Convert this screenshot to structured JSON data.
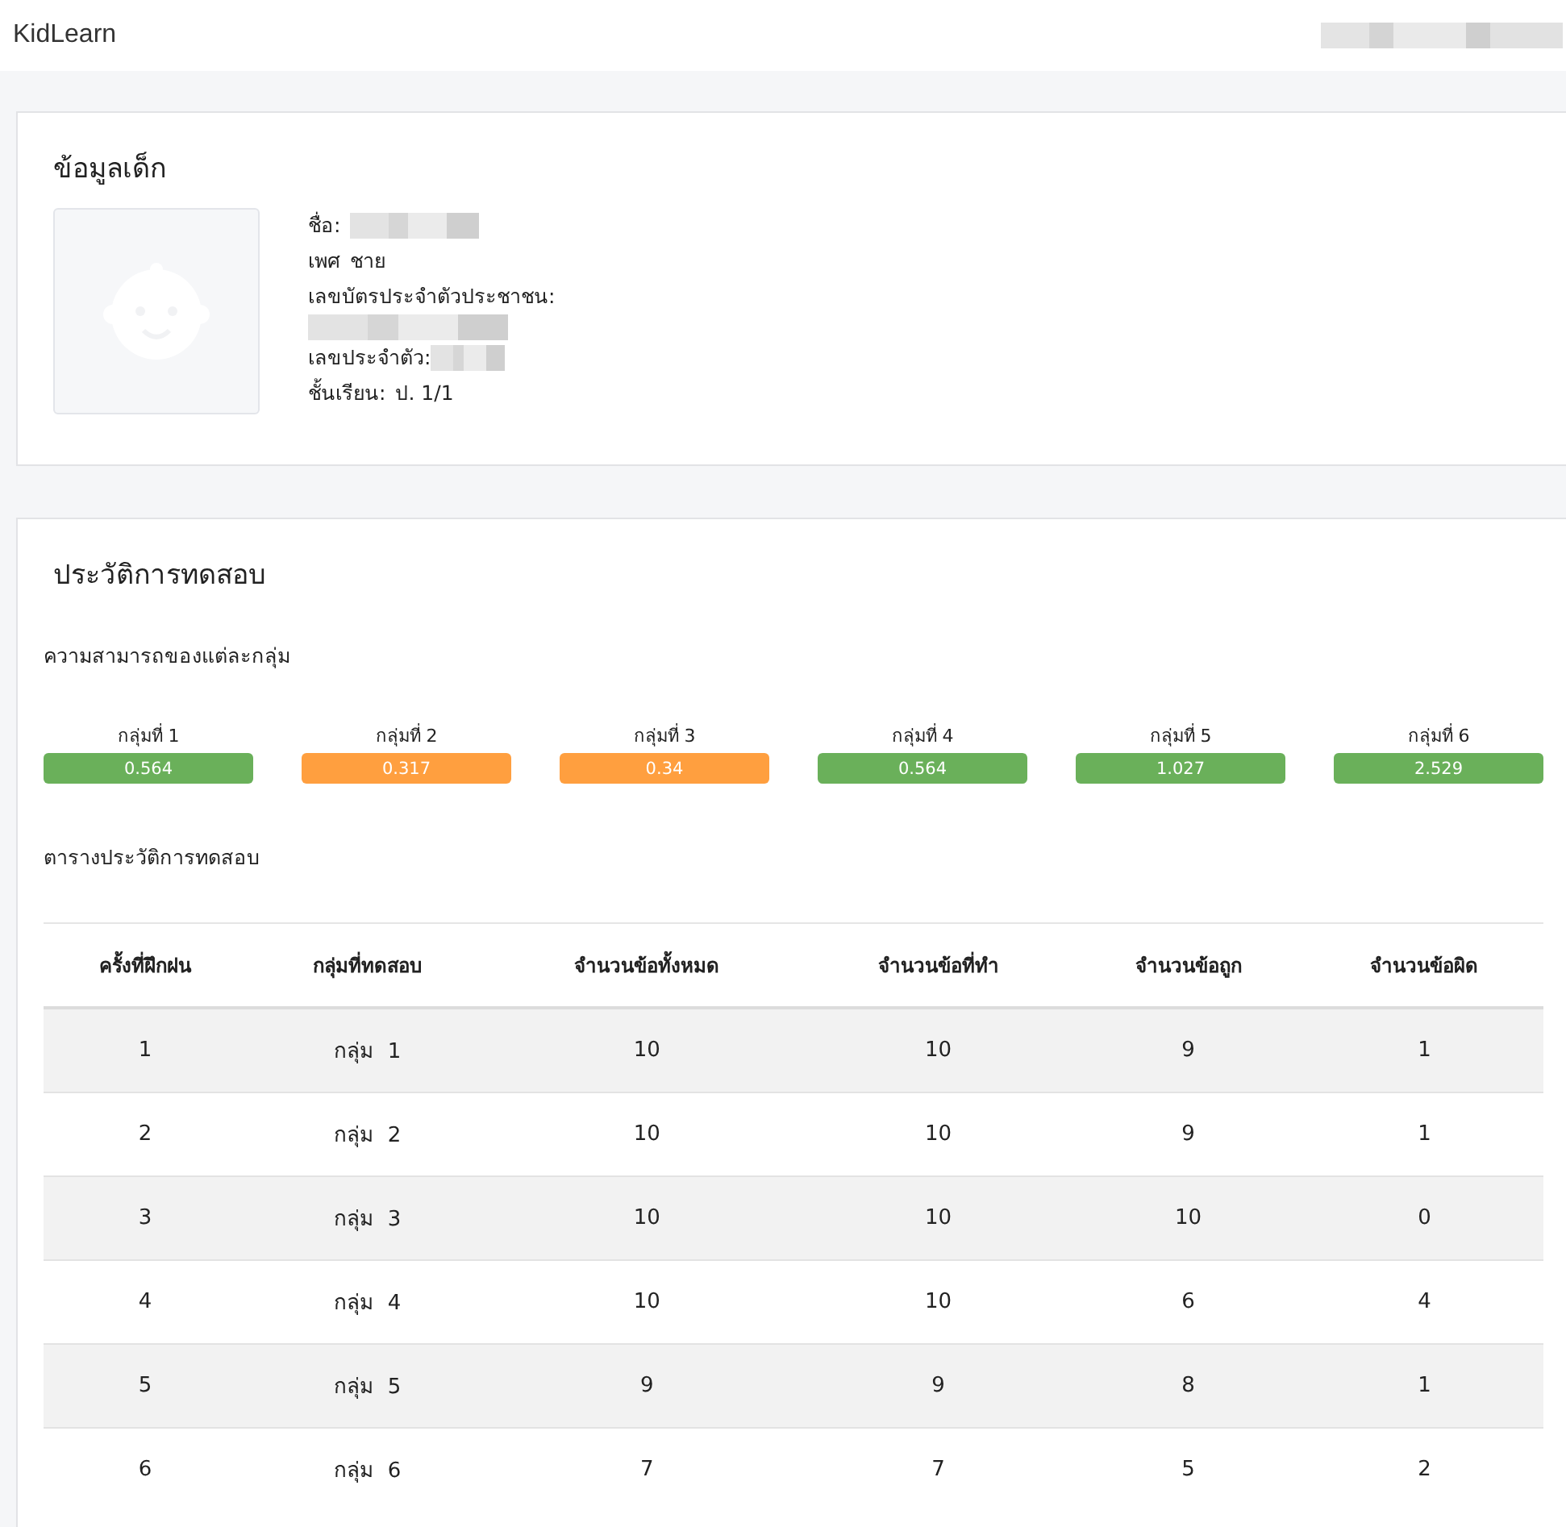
{
  "app_name": "KidLearn",
  "child_info": {
    "title": "ข้อมูลเด็ก",
    "name_label": "ชื่อ:",
    "gender_label": "เพศ",
    "gender": "ชาย",
    "id_card_label": "เลขบัตรประจำตัวประชาชน:",
    "student_id_label": "เลขประจำตัว:",
    "grade_label": "ชั้นเรียน:",
    "grade": "ป. 1/1"
  },
  "history": {
    "title": "ประวัติการทดสอบ",
    "ability_title": "ความสามารถของแต่ละกลุ่ม",
    "groups": [
      {
        "label": "กลุ่มที่ 1",
        "value": "0.564",
        "color": "#6ab05a"
      },
      {
        "label": "กลุ่มที่ 2",
        "value": "0.317",
        "color": "#ff9f3f"
      },
      {
        "label": "กลุ่มที่ 3",
        "value": "0.34",
        "color": "#ff9f3f"
      },
      {
        "label": "กลุ่มที่ 4",
        "value": "0.564",
        "color": "#6ab05a"
      },
      {
        "label": "กลุ่มที่ 5",
        "value": "1.027",
        "color": "#6ab05a"
      },
      {
        "label": "กลุ่มที่ 6",
        "value": "2.529",
        "color": "#6ab05a"
      }
    ],
    "table_title": "ตารางประวัติการทดสอบ",
    "table": {
      "columns": [
        "ครั้งที่ฝึกฝน",
        "กลุ่มที่ทดสอบ",
        "จำนวนข้อทั้งหมด",
        "จำนวนข้อที่ทำ",
        "จำนวนข้อถูก",
        "จำนวนข้อผิด"
      ],
      "rows": [
        [
          "1",
          "กลุ่ม  1",
          "10",
          "10",
          "9",
          "1"
        ],
        [
          "2",
          "กลุ่ม  2",
          "10",
          "10",
          "9",
          "1"
        ],
        [
          "3",
          "กลุ่ม  3",
          "10",
          "10",
          "10",
          "0"
        ],
        [
          "4",
          "กลุ่ม  4",
          "10",
          "10",
          "6",
          "4"
        ],
        [
          "5",
          "กลุ่ม  5",
          "9",
          "9",
          "8",
          "1"
        ],
        [
          "6",
          "กลุ่ม  6",
          "7",
          "7",
          "5",
          "2"
        ]
      ]
    }
  }
}
